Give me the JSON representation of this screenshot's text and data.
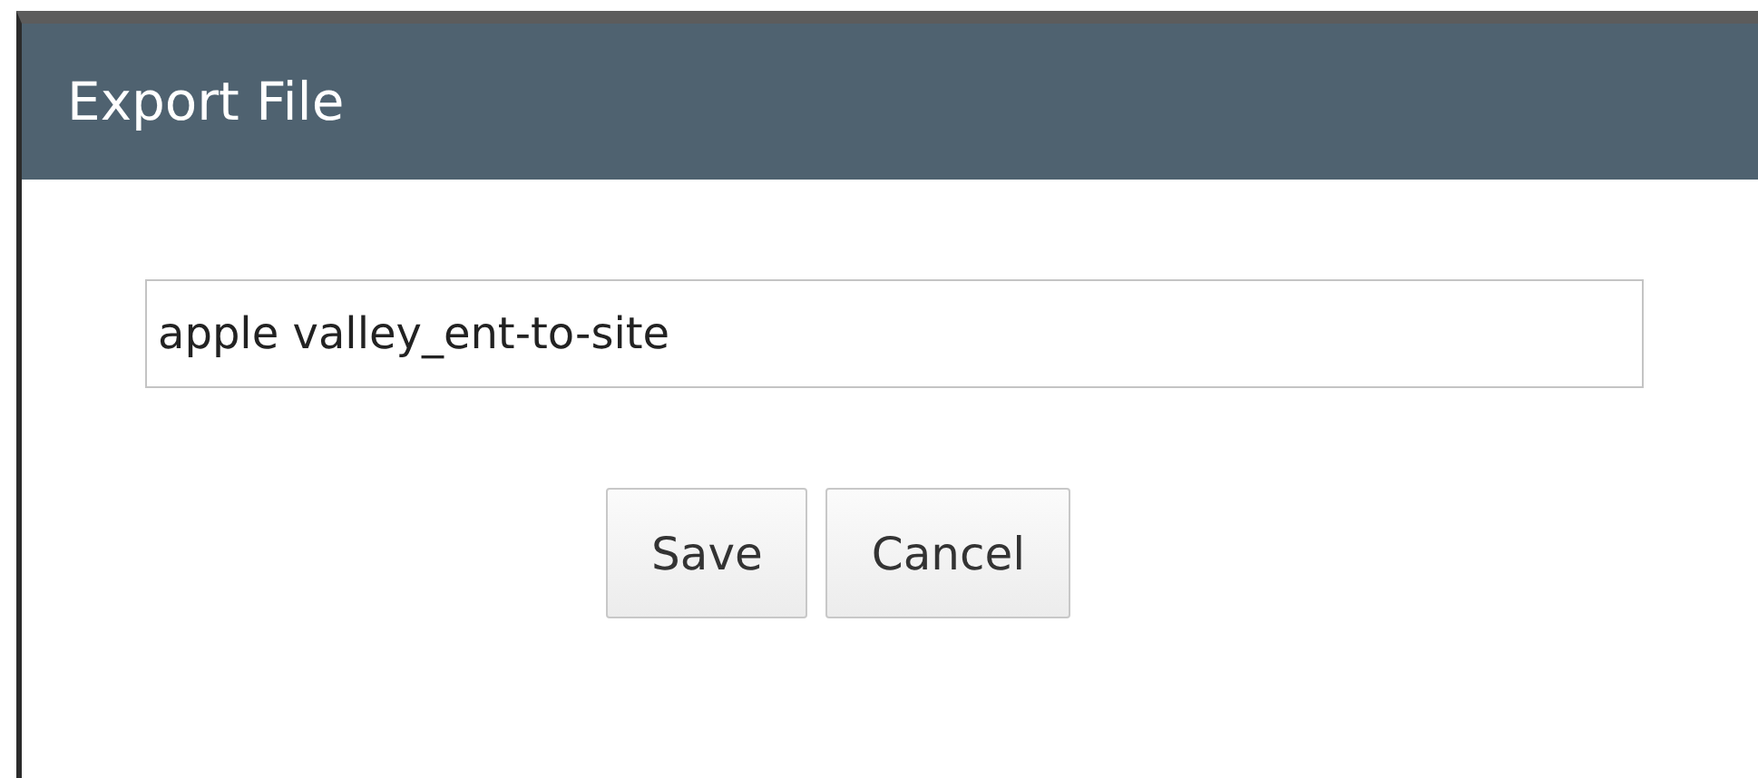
{
  "dialog": {
    "title": "Export File",
    "filename": {
      "value": "apple valley_ent-to-site"
    },
    "buttons": [
      "Save",
      "Cancel"
    ]
  }
}
